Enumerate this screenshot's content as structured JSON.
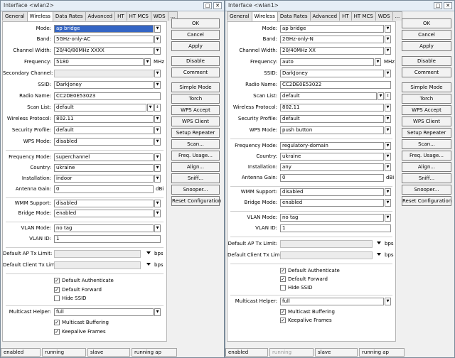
{
  "win1": {
    "title": "Interface <wlan2>",
    "controls": [
      "□",
      "✕"
    ],
    "tabs": [
      "General",
      "Wireless",
      "Data Rates",
      "Advanced",
      "HT",
      "HT MCS",
      "WDS",
      "..."
    ],
    "mode": "ap bridge",
    "band": "5GHz-only-AC",
    "channel_width": "20/40/80MHz XXXX",
    "frequency": "5180",
    "frequency_unit": "MHz",
    "secondary_channel": "",
    "ssid": "DarkJoney",
    "radio_name": "CC2DE0E53023",
    "scan_list": "default",
    "wireless_protocol": "802.11",
    "security_profile": "default",
    "wps_mode": "disabled",
    "frequency_mode": "superchannel",
    "country": "ukraine",
    "installation": "indoor",
    "antenna_gain": "0",
    "antenna_gain_unit": "dBi",
    "wmm_support": "disabled",
    "bridge_mode": "enabled",
    "vlan_mode": "no tag",
    "vlan_id": "1",
    "default_ap_tx_limit": "",
    "default_client_tx_limit": "",
    "tx_unit": "bps",
    "default_authenticate": "Default Authenticate",
    "default_forward": "Default Forward",
    "hide_ssid": "Hide SSID",
    "multicast_helper": "full",
    "multicast_buffering": "Multicast Buffering",
    "keepalive_frames": "Keepalive Frames",
    "status": [
      "enabled",
      "running",
      "slave",
      "running ap"
    ]
  },
  "win2": {
    "title": "Interface <wlan1>",
    "controls": [
      "□",
      "✕"
    ],
    "tabs": [
      "General",
      "Wireless",
      "Data Rates",
      "Advanced",
      "HT",
      "HT MCS",
      "WDS",
      "..."
    ],
    "mode": "ap bridge",
    "band": "2GHz-only-N",
    "channel_width": "20/40MHz XX",
    "frequency": "auto",
    "frequency_unit": "MHz",
    "ssid": "DarkJoney",
    "radio_name": "CC2DE0E53022",
    "scan_list": "default",
    "wireless_protocol": "802.11",
    "security_profile": "default",
    "wps_mode": "push button",
    "frequency_mode": "regulatory-domain",
    "country": "ukraine",
    "installation": "any",
    "antenna_gain": "0",
    "antenna_gain_unit": "dBi",
    "wmm_support": "disabled",
    "bridge_mode": "enabled",
    "vlan_mode": "no tag",
    "vlan_id": "1",
    "default_ap_tx_limit": "",
    "default_client_tx_limit": "",
    "tx_unit": "bps",
    "default_authenticate": "Default Authenticate",
    "default_forward": "Default Forward",
    "hide_ssid": "Hide SSID",
    "multicast_helper": "full",
    "multicast_buffering": "Multicast Buffering",
    "keepalive_frames": "Keepalive Frames",
    "status": [
      "enabled",
      "running",
      "slave",
      "running ap"
    ]
  },
  "labels": {
    "mode": "Mode:",
    "band": "Band:",
    "channel_width": "Channel Width:",
    "frequency": "Frequency:",
    "secondary_channel": "Secondary Channel:",
    "ssid": "SSID:",
    "radio_name": "Radio Name:",
    "scan_list": "Scan List:",
    "wireless_protocol": "Wireless Protocol:",
    "security_profile": "Security Profile:",
    "wps_mode": "WPS Mode:",
    "frequency_mode": "Frequency Mode:",
    "country": "Country:",
    "installation": "Installation:",
    "antenna_gain": "Antenna Gain:",
    "wmm_support": "WMM Support:",
    "bridge_mode": "Bridge Mode:",
    "vlan_mode": "VLAN Mode:",
    "vlan_id": "VLAN ID:",
    "default_ap_tx_limit": "Default AP Tx Limit:",
    "default_client_tx_limit": "Default Client Tx Limit:",
    "multicast_helper": "Multicast Helper:"
  },
  "buttons": [
    "OK",
    "Cancel",
    "Apply",
    "Disable",
    "Comment",
    "Simple Mode",
    "Torch",
    "WPS Accept",
    "WPS Client",
    "Setup Repeater",
    "Scan...",
    "Freq. Usage...",
    "Align...",
    "Sniff...",
    "Snooper...",
    "Reset Configuration"
  ],
  "glyphs": {
    "dropdown": "▼",
    "scroll": "⇕",
    "check": "✓"
  }
}
